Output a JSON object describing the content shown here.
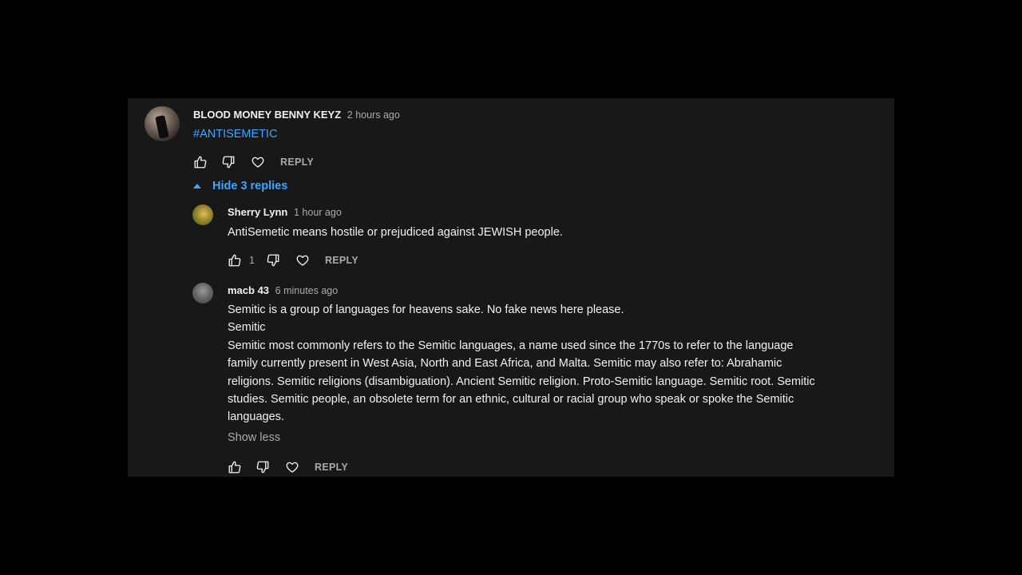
{
  "colors": {
    "background": "#000000",
    "panel": "#181818",
    "text": "#f1f1f1",
    "muted": "#aaaaaa",
    "link": "#3ea6ff"
  },
  "comment": {
    "author": "BLOOD MONEY BENNY KEYZ",
    "time": "2 hours ago",
    "text": "#ANTISEMETIC",
    "reply_label": "REPLY",
    "icons": [
      "thumb-up-icon",
      "thumb-down-icon",
      "heart-icon"
    ]
  },
  "toggle_replies": {
    "label": "Hide 3 replies",
    "icon": "caret-up-icon"
  },
  "replies": [
    {
      "author": "Sherry Lynn",
      "time": "1 hour ago",
      "text_lines": [
        "AntiSemetic means hostile or prejudiced against JEWISH people."
      ],
      "like_count": "1",
      "reply_label": "REPLY"
    },
    {
      "author": "macb 43",
      "time": "6 minutes ago",
      "text_lines": [
        "Semitic is a group of languages for heavens sake. No fake news here please.",
        "Semitic",
        "Semitic most commonly refers to the Semitic languages, a name used since the 1770s to refer to the language",
        "family currently present in West Asia, North and East Africa, and Malta. Semitic may also refer to: Abrahamic",
        "religions. Semitic religions (disambiguation). Ancient Semitic religion. Proto-Semitic language. Semitic root. Semitic",
        "studies. Semitic people, an obsolete term for an ethnic, cultural or racial group who speak or spoke the Semitic",
        "languages."
      ],
      "show_less_label": "Show less",
      "reply_label": "REPLY"
    }
  ]
}
